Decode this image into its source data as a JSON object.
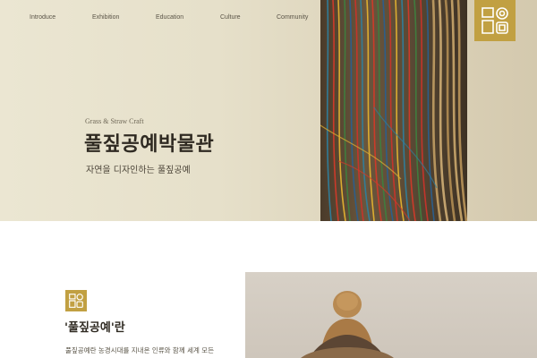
{
  "nav": {
    "items": [
      {
        "label": "Introduce"
      },
      {
        "label": "Exhibition"
      },
      {
        "label": "Education"
      },
      {
        "label": "Culture"
      },
      {
        "label": "Community"
      }
    ]
  },
  "logo": {
    "icon": "museum-logo-icon",
    "color": "#c1a042"
  },
  "hero": {
    "subtitle_en": "Grass & Straw Craft",
    "title": "풀짚공예박물관",
    "tagline": "자연을 디자인하는 풀짚공예",
    "image": "colored-straw-strands-image"
  },
  "intro": {
    "logo_icon": "museum-logo-icon",
    "title": "'풀짚공예'란",
    "text": "풀짚공예란 농경시대를 지내온 인류와 함께 세계 모든"
  },
  "photo": {
    "image": "straw-sculpture-photo"
  },
  "colors": {
    "accent": "#c1a042",
    "hero_bg": "#e8e2cd",
    "text_dark": "#2f2a22"
  }
}
